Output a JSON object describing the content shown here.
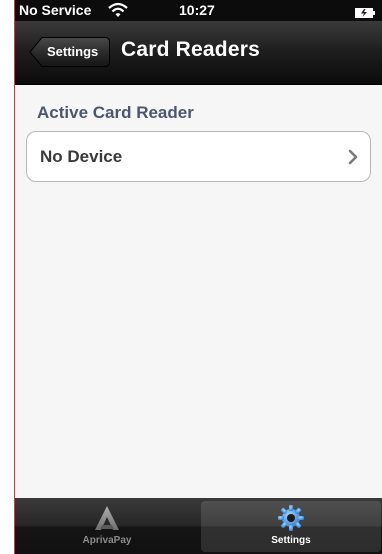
{
  "status_bar": {
    "carrier": "No Service",
    "time": "10:27"
  },
  "nav": {
    "back_label": "Settings",
    "title": "Card Readers"
  },
  "section": {
    "header": "Active Card Reader",
    "rows": [
      {
        "label": "No Device"
      }
    ]
  },
  "tab_bar": {
    "selected": "Settings",
    "tabs": [
      {
        "label": "AprivaPay",
        "icon": "apriva-logo-icon"
      },
      {
        "label": "Settings",
        "icon": "gear-icon"
      }
    ]
  },
  "colors": {
    "section_header": "#4c566c",
    "bars": "#0c0c0c",
    "accent_gear": "#3a8bd8"
  }
}
